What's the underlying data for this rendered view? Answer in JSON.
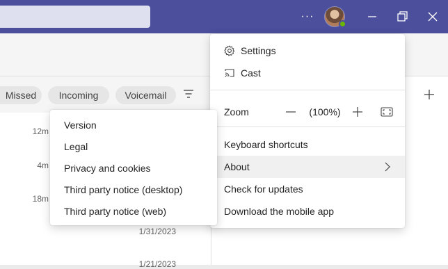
{
  "titlebar": {
    "more_label": "···",
    "icons": [
      "more-icon",
      "minimize-icon",
      "restore-icon",
      "close-icon"
    ],
    "presence_color": "#6bb700",
    "accent": "#4b4f9c"
  },
  "filters": {
    "missed": "Missed",
    "incoming": "Incoming",
    "voicemail": "Voicemail"
  },
  "list": {
    "times": [
      "12m",
      "4m",
      "18m"
    ],
    "dates": [
      "1/31/2023",
      "1/21/2023"
    ]
  },
  "menu": {
    "settings": "Settings",
    "cast": "Cast",
    "zoom_label": "Zoom",
    "zoom_value": "(100%)",
    "keyboard_shortcuts": "Keyboard shortcuts",
    "about": "About",
    "check_updates": "Check for updates",
    "download_mobile": "Download the mobile app"
  },
  "about_submenu": {
    "items": [
      "Version",
      "Legal",
      "Privacy and cookies",
      "Third party notice (desktop)",
      "Third party notice (web)"
    ]
  }
}
